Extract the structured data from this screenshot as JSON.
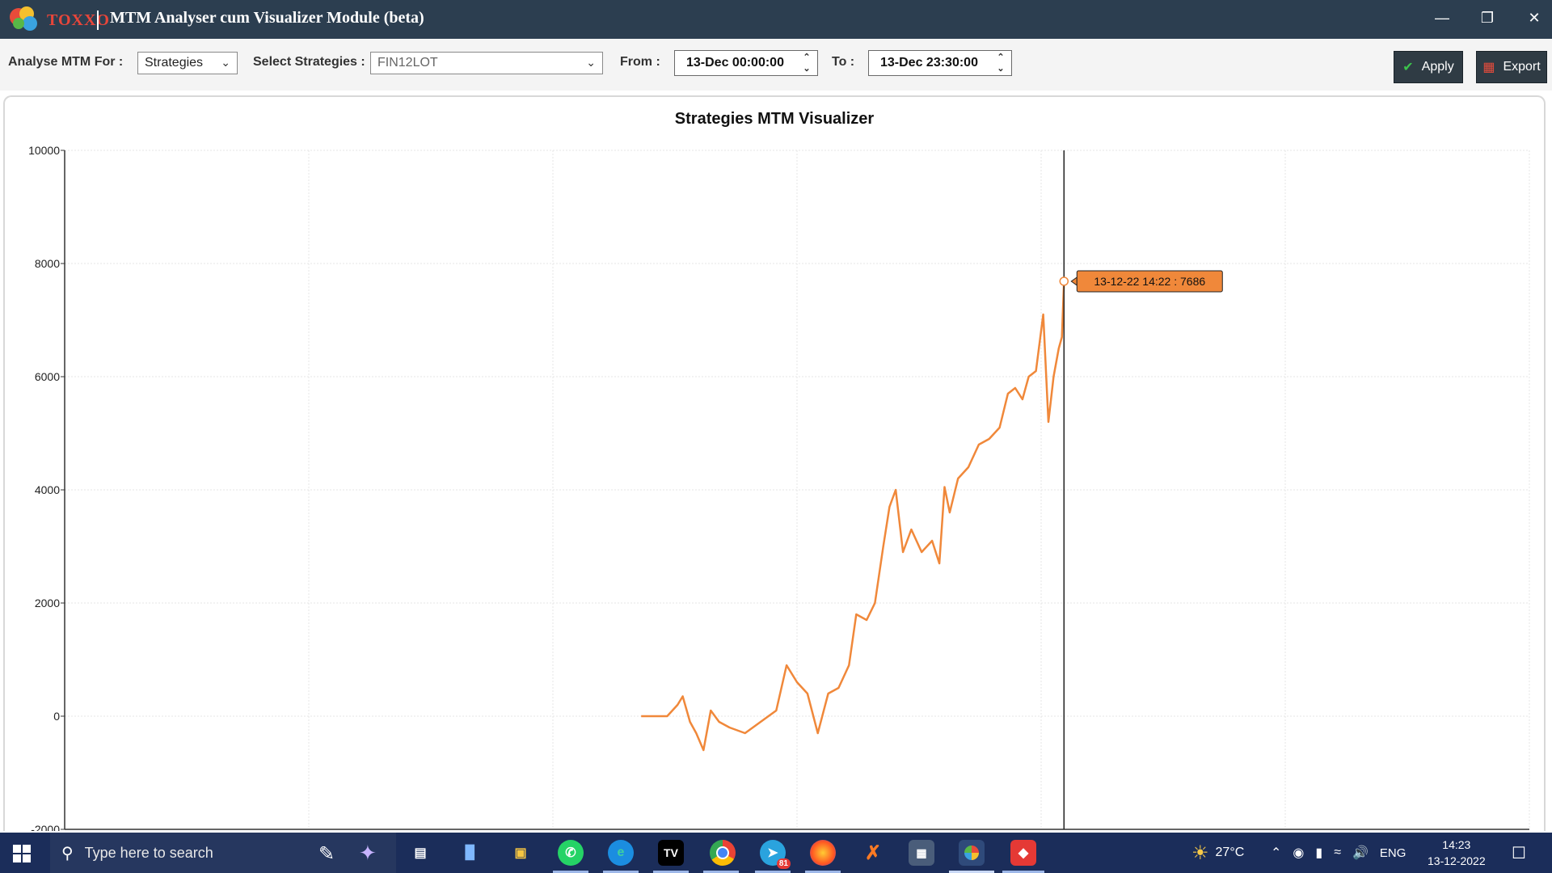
{
  "window": {
    "title": "MTM Analyser cum Visualizer Module (beta)",
    "brand": "TOXXO",
    "controls": {
      "minimize": "—",
      "restore": "❐",
      "close": "✕"
    }
  },
  "toolbar": {
    "analyse_label": "Analyse MTM For :",
    "analyse_value": "Strategies",
    "strategies_label": "Select Strategies :",
    "strategies_value": "FIN12LOT",
    "from_label": "From :",
    "from_value": "13-Dec  00:00:00",
    "to_label": "To :",
    "to_value": "13-Dec  23:30:00",
    "apply_label": "Apply",
    "export_label": "Export"
  },
  "chart_data": {
    "type": "line",
    "title": "Strategies MTM Visualizer",
    "xlabel": "",
    "ylabel": "",
    "ylim": [
      -2000,
      10000
    ],
    "yticks": [
      -2000,
      0,
      2000,
      4000,
      6000,
      8000,
      10000
    ],
    "grid": true,
    "x_domain": [
      "00:00",
      "23:30"
    ],
    "series": [
      {
        "color": "#f0883a",
        "points": [
          [
            "09:15",
            0
          ],
          [
            "09:40",
            0
          ],
          [
            "09:50",
            200
          ],
          [
            "09:55",
            350
          ],
          [
            "10:02",
            -100
          ],
          [
            "10:08",
            -300
          ],
          [
            "10:15",
            -600
          ],
          [
            "10:22",
            100
          ],
          [
            "10:30",
            -100
          ],
          [
            "10:40",
            -200
          ],
          [
            "10:55",
            -300
          ],
          [
            "11:10",
            -100
          ],
          [
            "11:25",
            100
          ],
          [
            "11:35",
            900
          ],
          [
            "11:45",
            600
          ],
          [
            "11:55",
            400
          ],
          [
            "12:05",
            -300
          ],
          [
            "12:15",
            400
          ],
          [
            "12:25",
            500
          ],
          [
            "12:35",
            900
          ],
          [
            "12:42",
            1800
          ],
          [
            "12:52",
            1700
          ],
          [
            "13:00",
            2000
          ],
          [
            "13:08",
            3000
          ],
          [
            "13:14",
            3700
          ],
          [
            "13:20",
            4000
          ],
          [
            "13:27",
            2900
          ],
          [
            "13:35",
            3300
          ],
          [
            "13:45",
            2900
          ],
          [
            "13:55",
            3100
          ],
          [
            "14:02",
            2700
          ],
          [
            "14:07",
            4050
          ],
          [
            "14:12",
            3600
          ],
          [
            "14:20",
            4200
          ],
          [
            "14:30",
            4400
          ],
          [
            "14:40",
            4800
          ],
          [
            "14:50",
            4900
          ],
          [
            "15:00",
            5100
          ],
          [
            "15:08",
            5700
          ],
          [
            "15:15",
            5800
          ],
          [
            "15:22",
            5600
          ],
          [
            "15:28",
            6000
          ],
          [
            "15:35",
            6100
          ],
          [
            "15:42",
            7100
          ],
          [
            "15:47",
            5200
          ],
          [
            "15:52",
            6000
          ],
          [
            "15:57",
            6500
          ],
          [
            "16:00",
            6700
          ],
          [
            "16:02",
            7686
          ]
        ]
      }
    ],
    "crosshair": {
      "x": "16:02",
      "y": 7686
    },
    "tooltip": "13-12-22 14:22 : 7686"
  },
  "taskbar": {
    "search_placeholder": "Type here to search",
    "weather": "27°C",
    "language": "ENG",
    "time": "14:23",
    "date": "13-12-2022",
    "telegram_badge": "81",
    "apps": [
      "paint-icon",
      "satellite-icon",
      "task-view-icon",
      "laptop-icon",
      "file-explorer-icon",
      "whatsapp-icon",
      "edge-icon",
      "tradingview-icon",
      "chrome-icon",
      "telegram-icon",
      "firefox-icon",
      "xampp-icon",
      "calculator-icon",
      "toxxo-icon",
      "anydesk-icon"
    ]
  }
}
